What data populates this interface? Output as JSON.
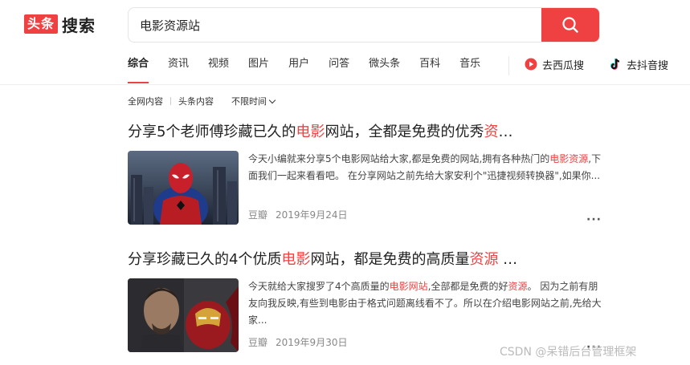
{
  "logo": {
    "box": "头条",
    "text": "搜索"
  },
  "search": {
    "value": "电影资源站",
    "button_icon": "search-icon"
  },
  "nav": {
    "tabs": [
      "综合",
      "资讯",
      "视频",
      "图片",
      "用户",
      "问答",
      "微头条",
      "百科",
      "音乐"
    ],
    "active_index": 0,
    "ext_xigua": {
      "label": "去西瓜搜",
      "icon": "xigua-icon"
    },
    "ext_douyin": {
      "label": "去抖音搜",
      "icon": "douyin-icon"
    }
  },
  "filters": {
    "all": "全网内容",
    "toutiao": "头条内容",
    "time": "不限时间"
  },
  "results": [
    {
      "title_pre": "分享5个老师傅珍藏已久的",
      "title_hl1": "电影",
      "title_mid": "网站，全都是免费的优秀",
      "title_hl2": "资",
      "title_post": "…",
      "desc_pre": "今天小编就来分享5个电影网站给大家,都是免费的网站,拥有各种热门的",
      "desc_hl": "电影资源",
      "desc_post": ",下面我们一起来看看吧。 在分享网站之前先给大家安利个\"迅捷视频转换器\",如果你...",
      "source": "豆瓣",
      "date": "2019年9月24日",
      "more": "···",
      "image": "spiderman"
    },
    {
      "title_pre": "分享珍藏已久的4个优质",
      "title_hl1": "电影",
      "title_mid": "网站，都是免费的高质量",
      "title_hl2": "资源",
      "title_post": " …",
      "desc_pre": "今天就给大家搜罗了4个高质量的",
      "desc_hl": "电影网站",
      "desc_mid": ",全部都是免费的好",
      "desc_hl2": "资源",
      "desc_post": "。 因为之前有朋友向我反映,有些到电影由于格式问题离线看不了。所以在介绍电影网站之前,先给大家...",
      "source": "豆瓣",
      "date": "2019年9月30日",
      "more": "···",
      "image": "ironman"
    }
  ],
  "watermark": "CSDN @呆错后台管理框架",
  "colors": {
    "accent": "#f04142"
  }
}
